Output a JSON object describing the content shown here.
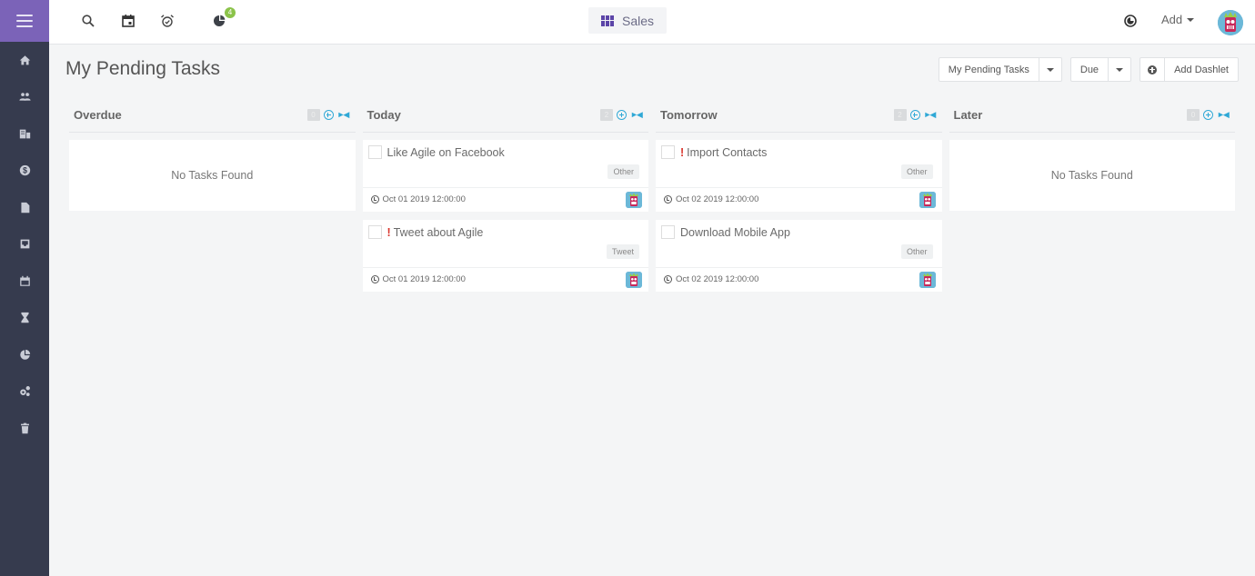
{
  "topbar": {
    "notification_count": "4",
    "app_switcher_label": "Sales",
    "add_label": "Add",
    "icons": [
      "search-icon",
      "calendar-icon",
      "alarm-icon",
      "pie-chart-icon",
      "theme-icon"
    ]
  },
  "sidebar": {
    "items": [
      {
        "name": "home",
        "icon": "home-icon"
      },
      {
        "name": "contacts",
        "icon": "people-icon"
      },
      {
        "name": "companies",
        "icon": "building-icon"
      },
      {
        "name": "deals",
        "icon": "dollar-icon"
      },
      {
        "name": "documents",
        "icon": "document-icon"
      },
      {
        "name": "inbox",
        "icon": "inbox-icon"
      },
      {
        "name": "calendar",
        "icon": "calendar-icon"
      },
      {
        "name": "tasks",
        "icon": "hourglass-icon"
      },
      {
        "name": "reports",
        "icon": "pie-chart-icon"
      },
      {
        "name": "settings",
        "icon": "gears-icon"
      },
      {
        "name": "trash",
        "icon": "trash-icon"
      }
    ]
  },
  "page": {
    "title": "My Pending Tasks",
    "filter_view": "My Pending Tasks",
    "group_by": "Due",
    "add_dashlet_label": "Add Dashlet"
  },
  "columns": [
    {
      "title": "Overdue",
      "count": "0",
      "empty_text": "No Tasks Found",
      "tasks": []
    },
    {
      "title": "Today",
      "count": "2",
      "empty_text": "",
      "tasks": [
        {
          "name": "Like Agile on Facebook",
          "priority_high": false,
          "tag": "Other",
          "due": "Oct 01 2019 12:00:00"
        },
        {
          "name": "Tweet about Agile",
          "priority_high": true,
          "tag": "Tweet",
          "due": "Oct 01 2019 12:00:00"
        }
      ]
    },
    {
      "title": "Tomorrow",
      "count": "2",
      "empty_text": "",
      "tasks": [
        {
          "name": "Import Contacts",
          "priority_high": true,
          "tag": "Other",
          "due": "Oct 02 2019 12:00:00"
        },
        {
          "name": "Download Mobile App",
          "priority_high": false,
          "tag": "Other",
          "due": "Oct 02 2019 12:00:00"
        }
      ]
    },
    {
      "title": "Later",
      "count": "0",
      "empty_text": "No Tasks Found",
      "tasks": []
    }
  ],
  "priority_mark": "!",
  "colors": {
    "sidebar_bg": "#363b4e",
    "sidebar_toggle": "#7b63b8",
    "accent_blue": "#2fa8d6",
    "priority_red": "#d9342b",
    "badge_green": "#8bc34a"
  }
}
